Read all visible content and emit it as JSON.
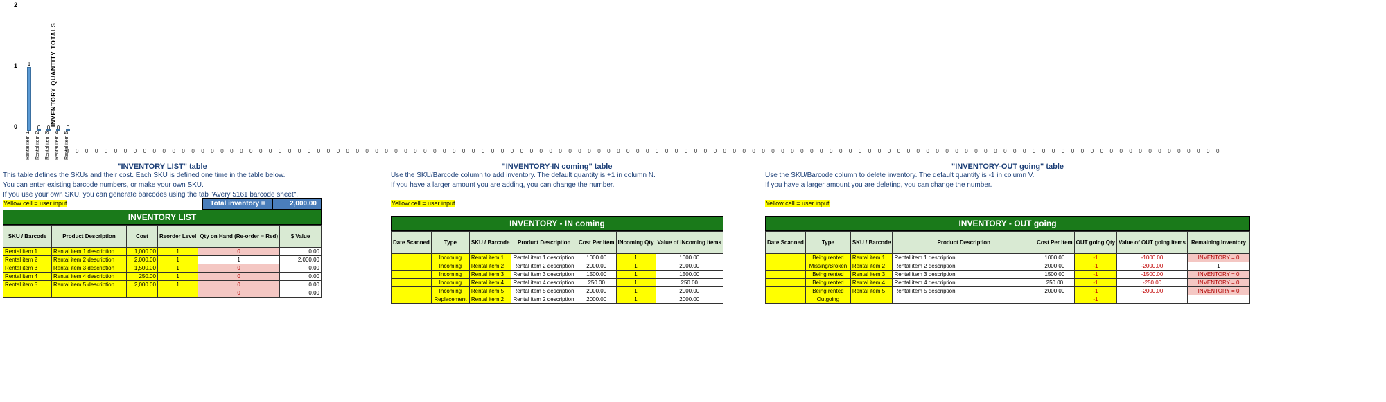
{
  "chart_data": {
    "type": "bar",
    "title": "",
    "ylabel": "INVENTORY QUANTITY TOTALS",
    "ylim": [
      0,
      2
    ],
    "yticks": [
      0,
      1,
      2
    ],
    "categories": [
      "Rental item 1",
      "Rental item 2",
      "Rental item 3",
      "Rental item 4",
      "Rental item 5"
    ],
    "values": [
      1,
      0,
      0,
      0,
      0
    ]
  },
  "left": {
    "title": "\"INVENTORY LIST\" table",
    "note1": "This table defines the SKUs and their cost. Each SKU is defined one time in the table below.",
    "note2": "You can enter existing barcode numbers, or make your own SKU.",
    "note3": "If you use your own SKU, you can generate barcodes using the tab \"Avery 5161 barcode sheet\".",
    "yellow": "Yellow cell = user input",
    "totlabel": "Total inventory =",
    "totval": "2,000.00",
    "band": "INVENTORY LIST",
    "cols": [
      "SKU / Barcode",
      "Product Description",
      "Cost",
      "Reorder Level",
      "Qty on Hand (Re-order = Red)",
      "$ Value"
    ],
    "rows": [
      {
        "sku": "Rental item 1",
        "desc": "Rental item 1 description",
        "cost": "1,000.00",
        "reord": "1",
        "qty": "0",
        "qred": true,
        "val": "0.00"
      },
      {
        "sku": "Rental item 2",
        "desc": "Rental item 2 description",
        "cost": "2,000.00",
        "reord": "1",
        "qty": "1",
        "qred": false,
        "val": "2,000.00"
      },
      {
        "sku": "Rental item 3",
        "desc": "Rental item 3 description",
        "cost": "1,500.00",
        "reord": "1",
        "qty": "0",
        "qred": true,
        "val": "0.00"
      },
      {
        "sku": "Rental item 4",
        "desc": "Rental item 4 description",
        "cost": "250.00",
        "reord": "1",
        "qty": "0",
        "qred": true,
        "val": "0.00"
      },
      {
        "sku": "Rental item 5",
        "desc": "Rental item 5 description",
        "cost": "2,000.00",
        "reord": "1",
        "qty": "0",
        "qred": true,
        "val": "0.00"
      },
      {
        "sku": "",
        "desc": "",
        "cost": "",
        "reord": "",
        "qty": "0",
        "qred": true,
        "val": "0.00"
      }
    ]
  },
  "mid": {
    "title": "\"INVENTORY-IN coming\" table",
    "note1": "Use the SKU/Barcode column to add inventory. The default quantity is +1 in column N.",
    "note2": "If you have a larger amount you are adding, you can change the number.",
    "yellow": "Yellow cell = user input",
    "band": "INVENTORY  -  IN coming",
    "cols": [
      "Date Scanned",
      "Type",
      "SKU / Barcode",
      "Product Description",
      "Cost Per Item",
      "INcoming Qty",
      "Value of INcoming items"
    ],
    "rows": [
      {
        "date": "",
        "type": "Incoming",
        "sku": "Rental item 1",
        "desc": "Rental item 1 description",
        "cpi": "1000.00",
        "qty": "1",
        "val": "1000.00"
      },
      {
        "date": "",
        "type": "Incoming",
        "sku": "Rental item 2",
        "desc": "Rental item 2 description",
        "cpi": "2000.00",
        "qty": "1",
        "val": "2000.00"
      },
      {
        "date": "",
        "type": "Incoming",
        "sku": "Rental item 3",
        "desc": "Rental item 3 description",
        "cpi": "1500.00",
        "qty": "1",
        "val": "1500.00"
      },
      {
        "date": "",
        "type": "Incoming",
        "sku": "Rental item 4",
        "desc": "Rental item 4 description",
        "cpi": "250.00",
        "qty": "1",
        "val": "250.00"
      },
      {
        "date": "",
        "type": "Incoming",
        "sku": "Rental item 5",
        "desc": "Rental item 5 description",
        "cpi": "2000.00",
        "qty": "1",
        "val": "2000.00"
      },
      {
        "date": "",
        "type": "Replacement",
        "sku": "Rental item 2",
        "desc": "Rental item 2 description",
        "cpi": "2000.00",
        "qty": "1",
        "val": "2000.00"
      }
    ]
  },
  "right": {
    "title": "\"INVENTORY-OUT going\" table",
    "note1": "Use the SKU/Barcode column to delete inventory. The default quantity is -1 in column V.",
    "note2": "If you have a larger amount you are deleting, you can change the number.",
    "yellow": "Yellow cell = user input",
    "band": "INVENTORY  -  OUT going",
    "cols": [
      "Date Scanned",
      "Type",
      "SKU / Barcode",
      "Product Description",
      "Cost Per Item",
      "OUT going Qty",
      "Value of OUT going items",
      "Remaining Inventory"
    ],
    "rows": [
      {
        "date": "",
        "type": "Being rented",
        "sku": "Rental item 1",
        "desc": "Rental item 1 description",
        "cpi": "1000.00",
        "qty": "-1",
        "val": "-1000.00",
        "rem": "INVENTORY = 0",
        "remred": true
      },
      {
        "date": "",
        "type": "Missing/Broken",
        "sku": "Rental item 2",
        "desc": "Rental item 2 description",
        "cpi": "2000.00",
        "qty": "-1",
        "val": "-2000.00",
        "rem": "1",
        "remred": false
      },
      {
        "date": "",
        "type": "Being rented",
        "sku": "Rental item 3",
        "desc": "Rental item 3 description",
        "cpi": "1500.00",
        "qty": "-1",
        "val": "-1500.00",
        "rem": "INVENTORY = 0",
        "remred": true
      },
      {
        "date": "",
        "type": "Being rented",
        "sku": "Rental item 4",
        "desc": "Rental item 4 description",
        "cpi": "250.00",
        "qty": "-1",
        "val": "-250.00",
        "rem": "INVENTORY = 0",
        "remred": true
      },
      {
        "date": "",
        "type": "Being rented",
        "sku": "Rental item 5",
        "desc": "Rental item 5 description",
        "cpi": "2000.00",
        "qty": "-1",
        "val": "-2000.00",
        "rem": "INVENTORY = 0",
        "remred": true
      },
      {
        "date": "",
        "type": "Outgoing",
        "sku": "",
        "desc": "",
        "cpi": "",
        "qty": "-1",
        "val": "",
        "rem": "",
        "remred": false
      }
    ]
  }
}
